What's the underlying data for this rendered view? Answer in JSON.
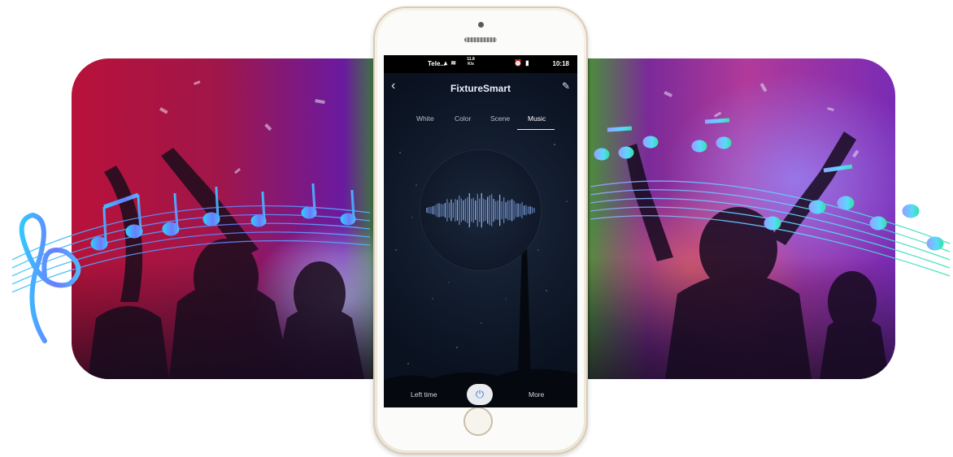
{
  "statusbar": {
    "carrier": "Tele...",
    "network_speed": "11.8 K/s",
    "time": "10:18"
  },
  "app": {
    "title": "FixtureSmart",
    "back_icon": "chevron-left-icon",
    "edit_icon": "pencil-icon"
  },
  "tabs": [
    {
      "label": "White"
    },
    {
      "label": "Color"
    },
    {
      "label": "Scene"
    },
    {
      "label": "Music"
    }
  ],
  "active_tab": "Music",
  "bottom": {
    "left_time_label": "Left time",
    "more_label": "More",
    "power_icon": "power-icon"
  },
  "colors": {
    "music_note_gradient": [
      "#3ab8ff",
      "#7a6cff",
      "#39e0b0"
    ],
    "power_icon_color": "#3f79c9"
  }
}
